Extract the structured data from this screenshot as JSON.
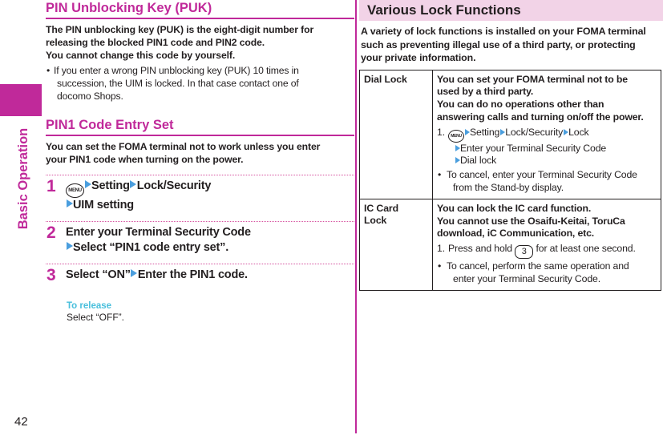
{
  "page": {
    "number": "42",
    "side_tab_label": "Basic Operation",
    "accent_magenta": "#c0299a",
    "accent_pink_bar": "#f2d3e7",
    "accent_blue_arrow": "#4a9ede",
    "accent_cyan": "#49bfdc"
  },
  "left_column": {
    "section1": {
      "heading": "PIN Unblocking Key (PUK)",
      "paragraph_line1": "The PIN unblocking key (PUK) is the eight-digit number for",
      "paragraph_line2": "releasing the blocked PIN1 code and PIN2 code.",
      "paragraph_line3": "You cannot change this code by yourself.",
      "bullet": {
        "marker": "•",
        "line1": "If you enter a wrong PIN unblocking key (PUK) 10 times in",
        "line2": "succession, the UIM is locked. In that case contact one of",
        "line3": "docomo Shops."
      }
    },
    "section2": {
      "heading": "PIN1 Code Entry Set",
      "paragraph_line1": "You can set the FOMA terminal not to work unless you enter",
      "paragraph_line2": "your PIN1 code when turning on the power.",
      "steps": [
        {
          "number": "1",
          "key_icon_label": "MENU",
          "line1_part1": "Setting",
          "line1_part2": "Lock/Security",
          "line2_part1": "UIM setting"
        },
        {
          "number": "2",
          "line1": "Enter your Terminal Security Code",
          "line2": "Select “PIN1 code entry set”."
        },
        {
          "number": "3",
          "line1_part1": "Select “ON”",
          "line1_part2": "Enter the PIN1 code."
        }
      ],
      "release": {
        "heading": "To release",
        "body": "Select “OFF”."
      }
    }
  },
  "right_column": {
    "title": "Various Lock Functions",
    "intro_line1": "A variety of lock functions is installed on your FOMA terminal",
    "intro_line2": "such as preventing illegal use of a third party, or protecting",
    "intro_line3": "your private information.",
    "table": {
      "rows": [
        {
          "name": "Dial Lock",
          "desc_bold_line1": "You can set your FOMA terminal not to be",
          "desc_bold_line2": "used by a third party.",
          "desc_bold_line3": "You can do no operations other than",
          "desc_bold_line4": "answering calls and turning on/off the power.",
          "step_number": "1.",
          "step_key_icon_label": "MENU",
          "step_line1_a": "Setting",
          "step_line1_b": "Lock/Security",
          "step_line1_c": "Lock",
          "step_line2": "Enter your Terminal Security Code",
          "step_line3": "Dial lock",
          "note_marker": "•",
          "note_line1": "To cancel, enter your Terminal Security Code",
          "note_line2": "from the Stand-by display."
        },
        {
          "name_line1": "IC Card",
          "name_line2": "Lock",
          "desc_bold_line1": "You can lock the IC card function.",
          "desc_bold_line2": "You cannot use the Osaifu-Keitai, ToruCa",
          "desc_bold_line3": "download, iC Communication, etc.",
          "step_number": "1.",
          "step_text_before_key": "Press and hold",
          "step_key_label": "3",
          "step_text_after_key": "for at least one second.",
          "note_marker": "•",
          "note_line1": "To cancel, perform the same operation and",
          "note_line2": "enter your Terminal Security Code."
        }
      ]
    }
  }
}
